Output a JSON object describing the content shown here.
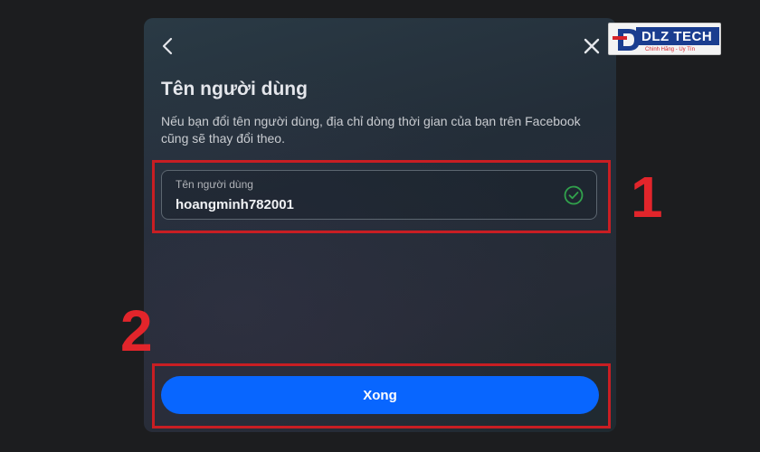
{
  "modal": {
    "title": "Tên người dùng",
    "description": "Nếu bạn đổi tên người dùng, địa chỉ dòng thời gian của bạn trên Facebook cũng sẽ thay đổi theo.",
    "field": {
      "label": "Tên người dùng",
      "value": "hoangminh782001"
    },
    "done_label": "Xong",
    "icons": {
      "back": "chevron-left-icon",
      "close": "close-icon",
      "valid": "check-circle-icon"
    }
  },
  "annotations": {
    "step1": "1",
    "step2": "2"
  },
  "logo": {
    "text": "DLZ TECH",
    "tagline": "Chính Hãng - Uy Tín"
  },
  "colors": {
    "background": "#1c1d1f",
    "primary_button": "#0866ff",
    "valid_check": "#31a24c",
    "highlight": "#c81e23"
  }
}
